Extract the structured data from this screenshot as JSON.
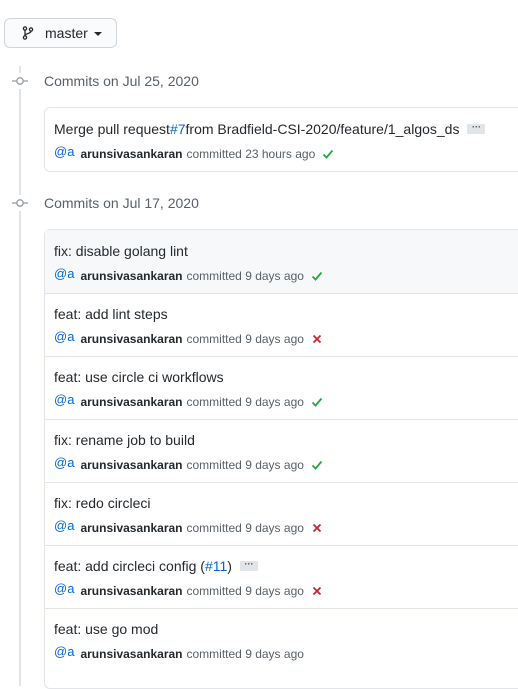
{
  "branch": {
    "label": "master",
    "icon": "git-branch-icon"
  },
  "groups": [
    {
      "title": "Commits on Jul 25, 2020",
      "commits": [
        {
          "msg_before": "Merge pull request ",
          "link": "#7",
          "msg_after": " from Bradfield-CSI-2020/feature/1_algos_ds",
          "ellipsis": "···",
          "avatar": "@a",
          "author": "arunsivasankaran",
          "action": "committed",
          "time": "23 hours ago",
          "status": "success"
        }
      ]
    },
    {
      "title": "Commits on Jul 17, 2020",
      "commits": [
        {
          "msg_before": "fix: disable golang lint",
          "avatar": "@a",
          "author": "arunsivasankaran",
          "action": "committed",
          "time": "9 days ago",
          "status": "success"
        },
        {
          "msg_before": "feat: add lint steps",
          "avatar": "@a",
          "author": "arunsivasankaran",
          "action": "committed",
          "time": "9 days ago",
          "status": "failure"
        },
        {
          "msg_before": "feat: use circle ci workflows",
          "avatar": "@a",
          "author": "arunsivasankaran",
          "action": "committed",
          "time": "9 days ago",
          "status": "success"
        },
        {
          "msg_before": "fix: rename job to build",
          "avatar": "@a",
          "author": "arunsivasankaran",
          "action": "committed",
          "time": "9 days ago",
          "status": "success"
        },
        {
          "msg_before": "fix: redo circleci",
          "avatar": "@a",
          "author": "arunsivasankaran",
          "action": "committed",
          "time": "9 days ago",
          "status": "failure"
        },
        {
          "msg_before": "feat: add circleci config (",
          "link": "#11",
          "msg_after": ")",
          "ellipsis": "···",
          "avatar": "@a",
          "author": "arunsivasankaran",
          "action": "committed",
          "time": "9 days ago",
          "status": "failure"
        },
        {
          "msg_before": "feat: use go mod",
          "avatar": "@a",
          "author": "arunsivasankaran",
          "action": "committed",
          "time": "9 days ago",
          "status": "none"
        }
      ]
    }
  ],
  "colors": {
    "success": "#28a745",
    "failure": "#cb2431",
    "link": "#0366d6"
  }
}
